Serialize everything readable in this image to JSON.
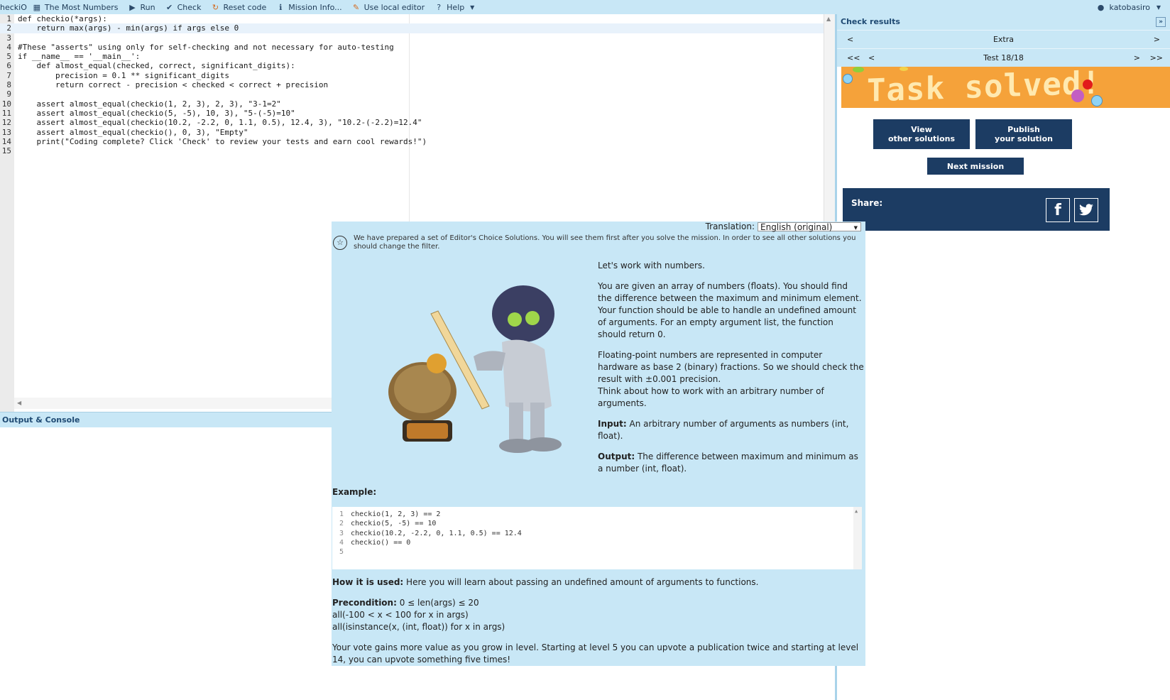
{
  "toolbar": {
    "logo": "heckiO",
    "mission_title": "The Most Numbers",
    "run": "Run",
    "check": "Check",
    "reset": "Reset code",
    "mission_info": "Mission Info...",
    "local_editor": "Use local editor",
    "help": "Help",
    "username": "katobasiro"
  },
  "editor": {
    "lines": [
      {
        "n": "1",
        "t": "def checkio(*args):"
      },
      {
        "n": "2",
        "t": "    return max(args) - min(args) if args else 0"
      },
      {
        "n": "3",
        "t": ""
      },
      {
        "n": "4",
        "t": "#These \"asserts\" using only for self-checking and not necessary for auto-testing"
      },
      {
        "n": "5",
        "t": "if __name__ == '__main__':"
      },
      {
        "n": "6",
        "t": "    def almost_equal(checked, correct, significant_digits):"
      },
      {
        "n": "7",
        "t": "        precision = 0.1 ** significant_digits"
      },
      {
        "n": "8",
        "t": "        return correct - precision < checked < correct + precision"
      },
      {
        "n": "9",
        "t": ""
      },
      {
        "n": "10",
        "t": "    assert almost_equal(checkio(1, 2, 3), 2, 3), \"3-1=2\""
      },
      {
        "n": "11",
        "t": "    assert almost_equal(checkio(5, -5), 10, 3), \"5-(-5)=10\""
      },
      {
        "n": "12",
        "t": "    assert almost_equal(checkio(10.2, -2.2, 0, 1.1, 0.5), 12.4, 3), \"10.2-(-2.2)=12.4\""
      },
      {
        "n": "13",
        "t": "    assert almost_equal(checkio(), 0, 3), \"Empty\""
      },
      {
        "n": "14",
        "t": "    print(\"Coding complete? Click 'Check' to review your tests and earn cool rewards!\")"
      },
      {
        "n": "15",
        "t": ""
      }
    ]
  },
  "console": {
    "title": "Output & Console"
  },
  "results": {
    "title": "Check results",
    "category": "Extra",
    "test_label": "Test 18/18",
    "first": "<<",
    "prev": "<",
    "next": ">",
    "last": ">>",
    "banner": "Task solved!",
    "view_btn_line1": "View",
    "view_btn_line2": "other solutions",
    "publish_btn_line1": "Publish",
    "publish_btn_line2": "your solution",
    "next_mission": "Next mission",
    "share": "Share:",
    "facebook": "f"
  },
  "mission": {
    "translation_label": "Translation:",
    "translation_value": "English (original)",
    "notice": "We have prepared a set of Editor's Choice Solutions. You will see them first after you solve the mission. In order to see all other solutions you should change the filter.",
    "p1": "Let's work with numbers.",
    "p2": "You are given an array of numbers (floats). You should find the difference between the maximum and minimum element. Your function should be able to handle an undefined amount of arguments. For an empty argument list, the function should return 0.",
    "p3a": "Floating-point numbers are represented in computer hardware as base 2 (binary) fractions. So we should check the result with ±0.001 precision.",
    "p3b": "Think about how to work with an arbitrary number of arguments.",
    "input_label": "Input:",
    "input_text": " An arbitrary number of arguments as numbers (int, float).",
    "output_label": "Output:",
    "output_text": " The difference between maximum and minimum as a number (int, float).",
    "example_label": "Example:",
    "example_lines": [
      {
        "n": "1",
        "t": "checkio(1, 2, 3) == 2"
      },
      {
        "n": "2",
        "t": "checkio(5, -5) == 10"
      },
      {
        "n": "3",
        "t": "checkio(10.2, -2.2, 0, 1.1, 0.5) == 12.4"
      },
      {
        "n": "4",
        "t": "checkio() == 0"
      },
      {
        "n": "5",
        "t": ""
      }
    ],
    "how_label": "How it is used:",
    "how_text": " Here you will learn about passing an undefined amount of arguments to functions.",
    "pre_label": "Precondition:",
    "pre_text": " 0 ≤ len(args) ≤ 20",
    "pre_line2": "all(-100 < x < 100 for x in args)",
    "pre_line3": "all(isinstance(x, (int, float)) for x in args)",
    "vote": "Your vote gains more value as you grow in level. Starting at level 5 you can upvote a publication twice and starting at level 14, you can upvote something five times!"
  }
}
